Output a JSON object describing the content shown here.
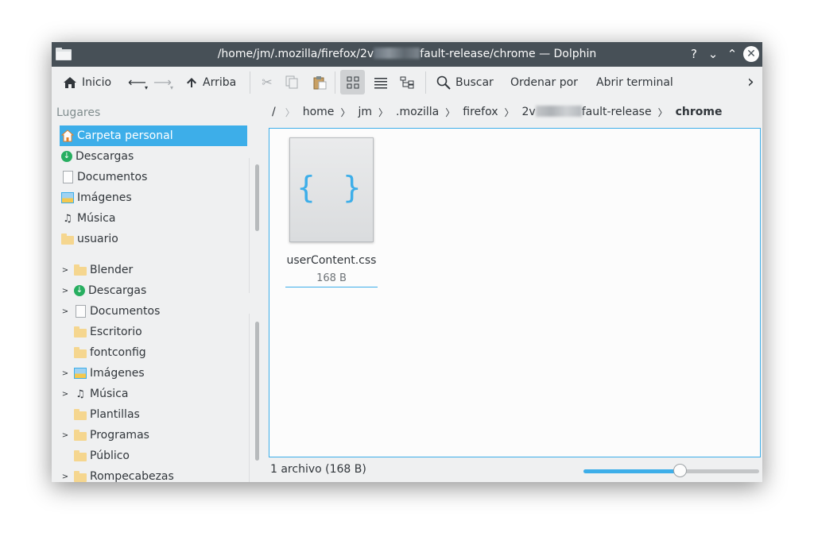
{
  "window": {
    "title_prefix": "/home/jm/.mozilla/firefox/2v",
    "title_suffix": "fault-release/chrome — Dolphin",
    "help_btn": "?",
    "minimize_btn": "⌄",
    "maximize_btn": "⌃",
    "close_btn": "✕"
  },
  "toolbar": {
    "home_label": "Inicio",
    "up_label": "Arriba",
    "search_label": "Buscar",
    "sort_label": "Ordenar por",
    "terminal_label": "Abrir terminal",
    "more_icon": "›"
  },
  "sidebar": {
    "places_title": "Lugares",
    "places": [
      {
        "label": "Carpeta personal",
        "icon": "home-icon",
        "selected": true
      },
      {
        "label": "Descargas",
        "icon": "download-icon"
      },
      {
        "label": "Documentos",
        "icon": "document-icon"
      },
      {
        "label": "Imágenes",
        "icon": "images-icon"
      },
      {
        "label": "Música",
        "icon": "music-icon"
      },
      {
        "label": "usuario",
        "icon": "folder-icon"
      }
    ],
    "tree": [
      {
        "label": "Blender",
        "icon": "folder-icon",
        "expandable": true
      },
      {
        "label": "Descargas",
        "icon": "download-icon",
        "expandable": true
      },
      {
        "label": "Documentos",
        "icon": "document-icon",
        "expandable": true
      },
      {
        "label": "Escritorio",
        "icon": "folder-icon",
        "expandable": false
      },
      {
        "label": "fontconfig",
        "icon": "folder-icon",
        "expandable": false
      },
      {
        "label": "Imágenes",
        "icon": "images-icon",
        "expandable": true
      },
      {
        "label": "Música",
        "icon": "music-icon",
        "expandable": true
      },
      {
        "label": "Plantillas",
        "icon": "folder-icon",
        "expandable": false
      },
      {
        "label": "Programas",
        "icon": "folder-icon",
        "expandable": true
      },
      {
        "label": "Público",
        "icon": "folder-icon",
        "expandable": false
      },
      {
        "label": "Rompecabezas",
        "icon": "folder-icon",
        "expandable": true
      }
    ]
  },
  "breadcrumb": {
    "root": "/",
    "items": [
      "home",
      "jm",
      ".mozilla",
      "firefox"
    ],
    "profile_prefix": "2v",
    "profile_suffix": "fault-release",
    "current": "chrome"
  },
  "files": [
    {
      "name": "userContent.css",
      "size": "168 B",
      "icon_glyph": "{ }"
    }
  ],
  "status": {
    "summary": "1 archivo (168 B)",
    "zoom_fraction": 0.55
  },
  "colors": {
    "accent": "#3daee9",
    "titlebar": "#475057",
    "window_bg": "#eff0f1"
  }
}
